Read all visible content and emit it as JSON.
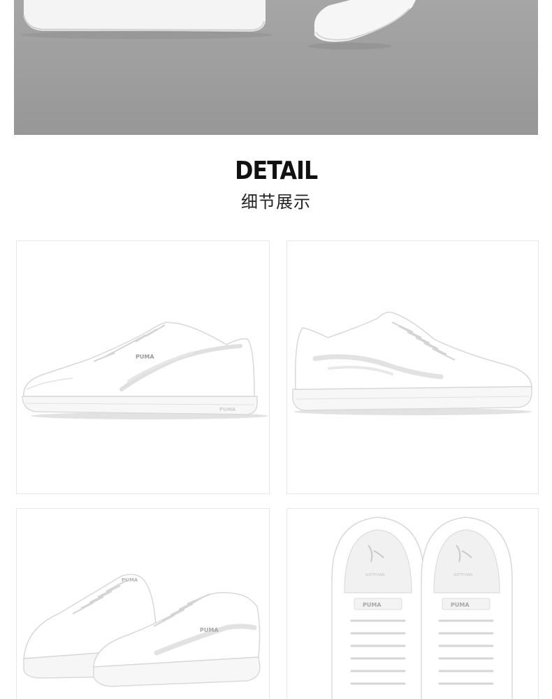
{
  "section": {
    "title_en": "DETAIL",
    "title_cn": "细节展示"
  },
  "hero": {
    "image": "lifestyle-photo-white-sneakers-gray-floor"
  },
  "gallery": {
    "items": [
      {
        "image": "shoe-side-view-left-facing",
        "brand_mark": "PUMA"
      },
      {
        "image": "shoe-side-view-right-facing"
      },
      {
        "image": "shoe-pair-angled-view",
        "brand_mark": "PUMA"
      },
      {
        "image": "shoe-pair-top-view",
        "brand_mark": "PUMA"
      }
    ]
  },
  "colors": {
    "background": "#ffffff",
    "hero_gray": "#a0a0a0",
    "title": "#111111",
    "card_border": "#e6e6e6"
  }
}
